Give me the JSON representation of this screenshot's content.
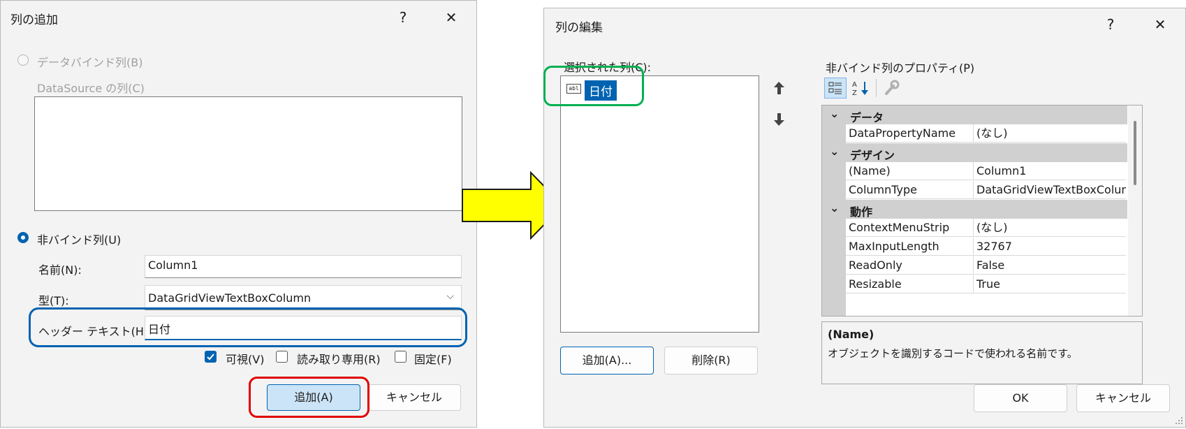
{
  "add_dialog": {
    "title": "列の追加",
    "help": "?",
    "close": "✕",
    "radio_databound": "データバインド列(B)",
    "datasource_label": "DataSource の列(C)",
    "radio_unbound": "非バインド列(U)",
    "name_label": "名前(N):",
    "name_value": "Column1",
    "type_label": "型(T):",
    "type_value": "DataGridViewTextBoxColumn",
    "header_label": "ヘッダー テキスト(H):",
    "header_value": "日付",
    "visible_label": "可視(V)",
    "readonly_label": "読み取り専用(R)",
    "frozen_label": "固定(F)",
    "add_button": "追加(A)",
    "cancel_button": "キャンセル"
  },
  "edit_dialog": {
    "title": "列の編集",
    "help": "?",
    "close": "✕",
    "selected_label": "選択された列(C):",
    "selected_items": [
      "日付"
    ],
    "props_label": "非バインド列のプロパティ(P)",
    "categories": {
      "data": "データ",
      "design": "デザイン",
      "behavior": "動作"
    },
    "properties": [
      {
        "name": "DataPropertyName",
        "value": "(なし)"
      },
      {
        "name": "(Name)",
        "value": "Column1"
      },
      {
        "name": "ColumnType",
        "value": "DataGridViewTextBoxColumn"
      },
      {
        "name": "ContextMenuStrip",
        "value": "(なし)"
      },
      {
        "name": "MaxInputLength",
        "value": "32767"
      },
      {
        "name": "ReadOnly",
        "value": "False"
      },
      {
        "name": "Resizable",
        "value": "True"
      }
    ],
    "desc_title": "(Name)",
    "desc_text": "オブジェクトを識別するコードで使われる名前です。",
    "add_button": "追加(A)...",
    "delete_button": "削除(R)",
    "ok_button": "OK",
    "cancel_button": "キャンセル"
  },
  "colors": {
    "accent": "#0063b1",
    "arrow": "#ffff00",
    "highlight_blue": "#0063b1",
    "highlight_red": "#e00000",
    "highlight_green": "#00b050"
  }
}
